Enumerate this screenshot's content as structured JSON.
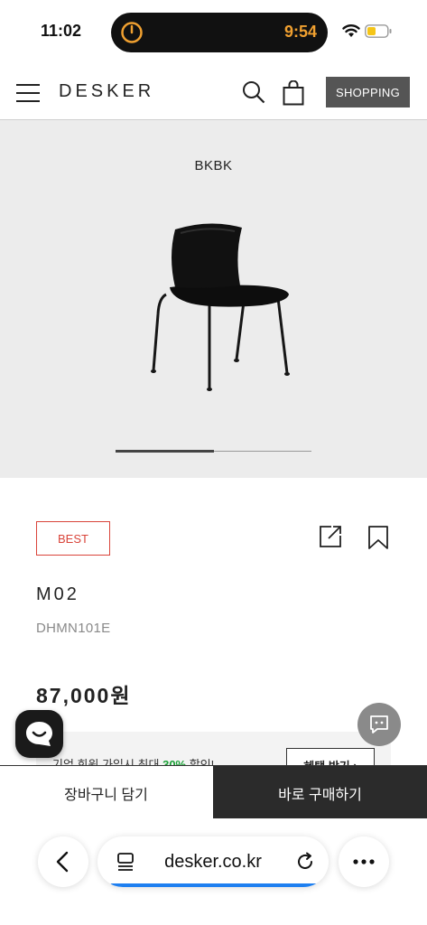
{
  "status_bar": {
    "time": "11:02",
    "island_time": "9:54"
  },
  "header": {
    "logo": "DESKER",
    "shopping_label": "SHOPPING"
  },
  "hero": {
    "label": "BKBK",
    "slider_progress": 0.5
  },
  "product": {
    "badge": "BEST",
    "name": "M02",
    "code": "DHMN101E",
    "price": "87,000원"
  },
  "promo": {
    "text_before": "기업 회원 가입시 최대 ",
    "highlight": "30%",
    "text_after": " 할인!",
    "button_label": "혜택 받기"
  },
  "actions": {
    "cart_label": "장바구니 담기",
    "buy_label": "바로 구매하기"
  },
  "browser": {
    "url": "desker.co.kr"
  },
  "colors": {
    "accent_red": "#d9443a",
    "promo_green": "#1aa036",
    "dark": "#2b2b2b",
    "progress_blue": "#1e7ff0"
  }
}
